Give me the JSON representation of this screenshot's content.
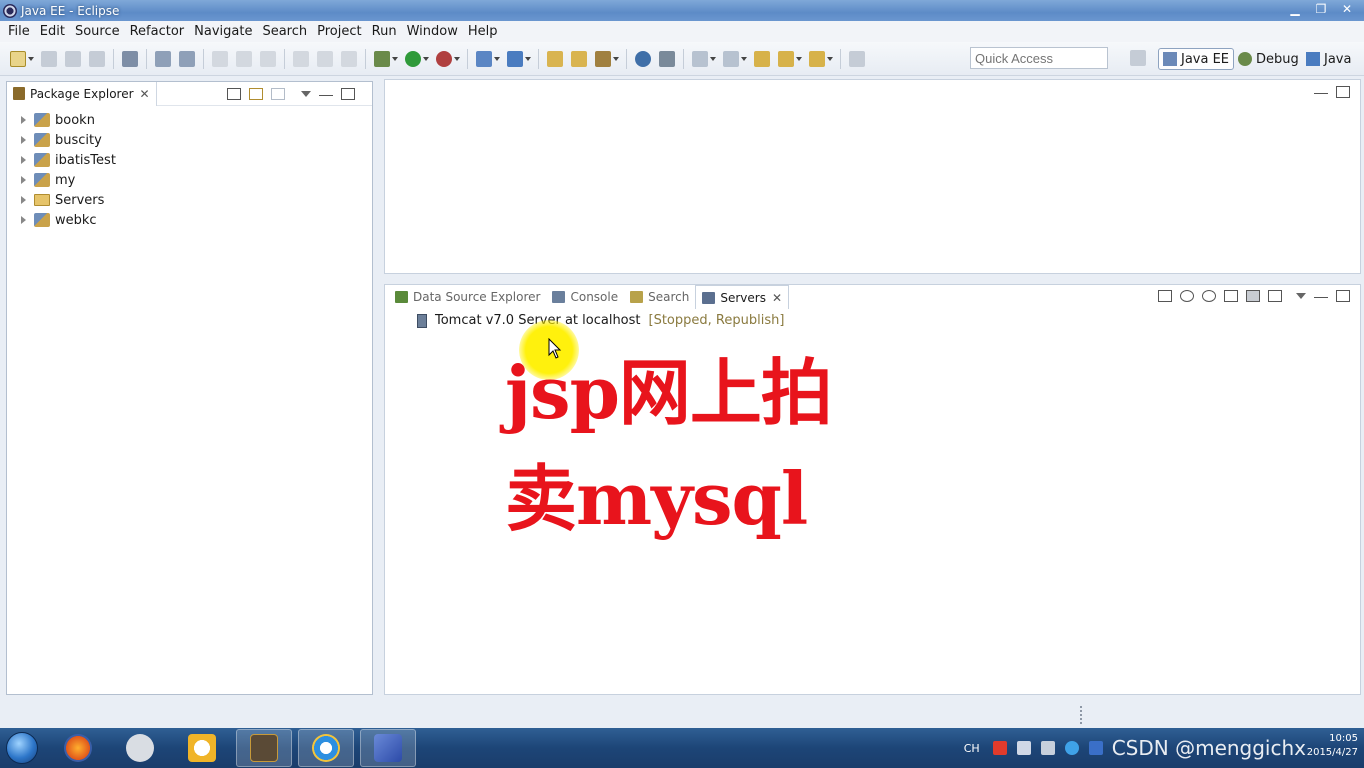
{
  "window": {
    "title": "Java EE - Eclipse"
  },
  "menu": [
    "File",
    "Edit",
    "Source",
    "Refactor",
    "Navigate",
    "Search",
    "Project",
    "Run",
    "Window",
    "Help"
  ],
  "toolbar": {
    "quick_access_placeholder": "Quick Access"
  },
  "perspectives": [
    {
      "label": "Java EE",
      "active": true
    },
    {
      "label": "Debug",
      "active": false
    },
    {
      "label": "Java",
      "active": false
    }
  ],
  "package_explorer": {
    "tab_label": "Package Explorer",
    "items": [
      {
        "label": "bookn",
        "type": "project"
      },
      {
        "label": "buscity",
        "type": "project"
      },
      {
        "label": "ibatisTest",
        "type": "project"
      },
      {
        "label": "my",
        "type": "project"
      },
      {
        "label": "Servers",
        "type": "folder"
      },
      {
        "label": "webkc",
        "type": "project"
      }
    ]
  },
  "bottom_views": {
    "tabs": [
      {
        "label": "Data Source Explorer",
        "active": false,
        "color": "#5a8a3a"
      },
      {
        "label": "Console",
        "active": false,
        "color": "#6a7f9c"
      },
      {
        "label": "Search",
        "active": false,
        "color": "#b8a24a"
      },
      {
        "label": "Servers",
        "active": true,
        "color": "#5b6f8f"
      }
    ],
    "server": {
      "name": "Tomcat v7.0 Server at localhost",
      "status": "[Stopped, Republish]"
    }
  },
  "overlay": {
    "line1": "jsp网上拍",
    "line2": "卖mysql"
  },
  "taskbar": {
    "lang": "CH",
    "watermark": "CSDN @menggichx",
    "time": "10:05",
    "date": "2015/4/27"
  },
  "colors": {
    "overlay_text": "#e8141c",
    "accent": "#2d5f96"
  }
}
